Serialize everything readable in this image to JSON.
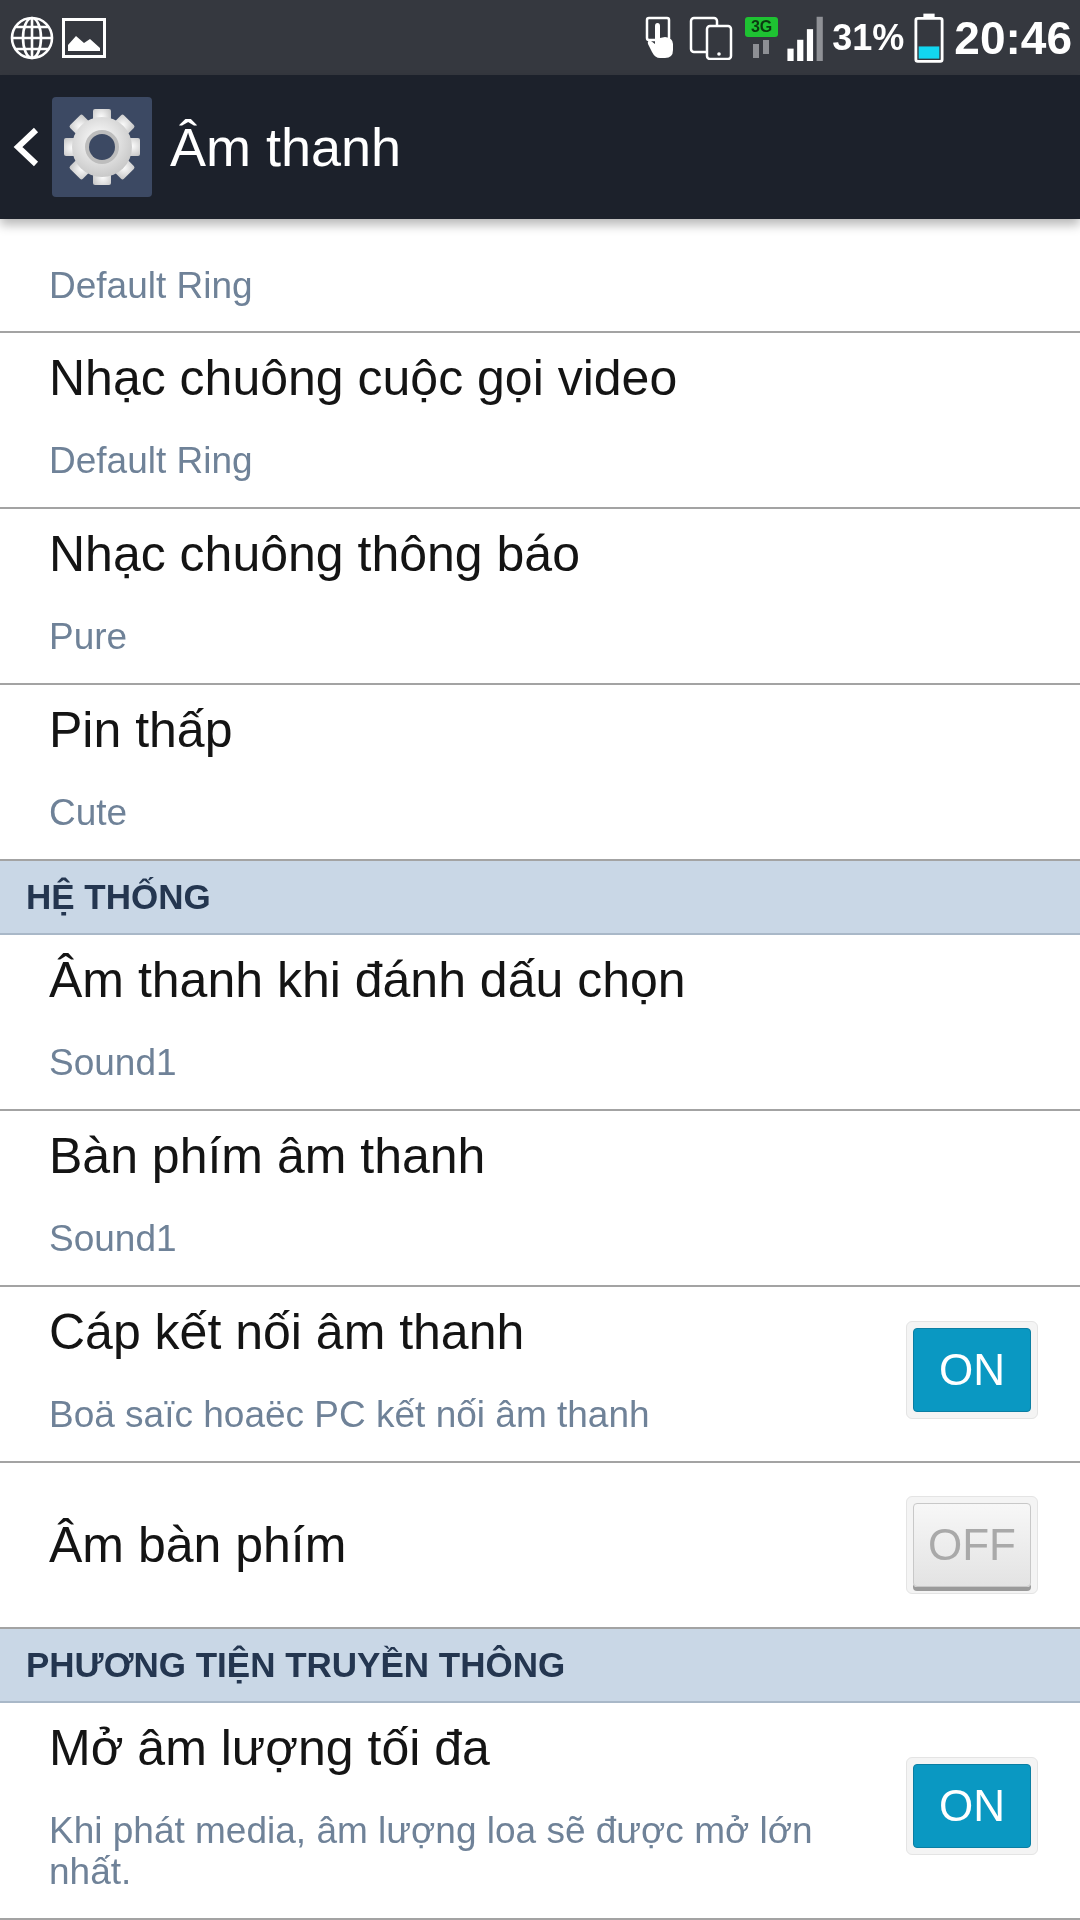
{
  "status_bar": {
    "network_type": "3G",
    "battery": "31%",
    "time": "20:46"
  },
  "app_bar": {
    "title": "Âm thanh"
  },
  "list": [
    {
      "kind": "entry",
      "summary": "Default Ring"
    },
    {
      "kind": "entry",
      "title": "Nhạc chuông cuộc gọi video",
      "summary": "Default Ring"
    },
    {
      "kind": "entry",
      "title": "Nhạc chuông thông báo",
      "summary": "Pure"
    },
    {
      "kind": "entry",
      "title": "Pin thấp",
      "summary": "Cute"
    },
    {
      "kind": "category",
      "title": "HỆ THỐNG"
    },
    {
      "kind": "entry",
      "title": "Âm thanh khi đánh dấu chọn",
      "summary": "Sound1"
    },
    {
      "kind": "entry",
      "title": "Bàn phím âm thanh",
      "summary": "Sound1"
    },
    {
      "kind": "toggle",
      "title": "Cáp kết nối âm thanh",
      "summary": "Boä saïc hoaëc PC kết nối âm thanh",
      "on": true,
      "switch_label": "ON"
    },
    {
      "kind": "toggle",
      "title": "Âm bàn phím",
      "on": false,
      "switch_label": "OFF"
    },
    {
      "kind": "category",
      "title": "PHƯƠNG TIỆN TRUYỀN THÔNG"
    },
    {
      "kind": "toggle",
      "title": "Mở âm lượng tối đa",
      "summary": "Khi phát media, âm lượng loa sẽ được mở lớn nhất.",
      "on": true,
      "switch_label": "ON"
    }
  ]
}
